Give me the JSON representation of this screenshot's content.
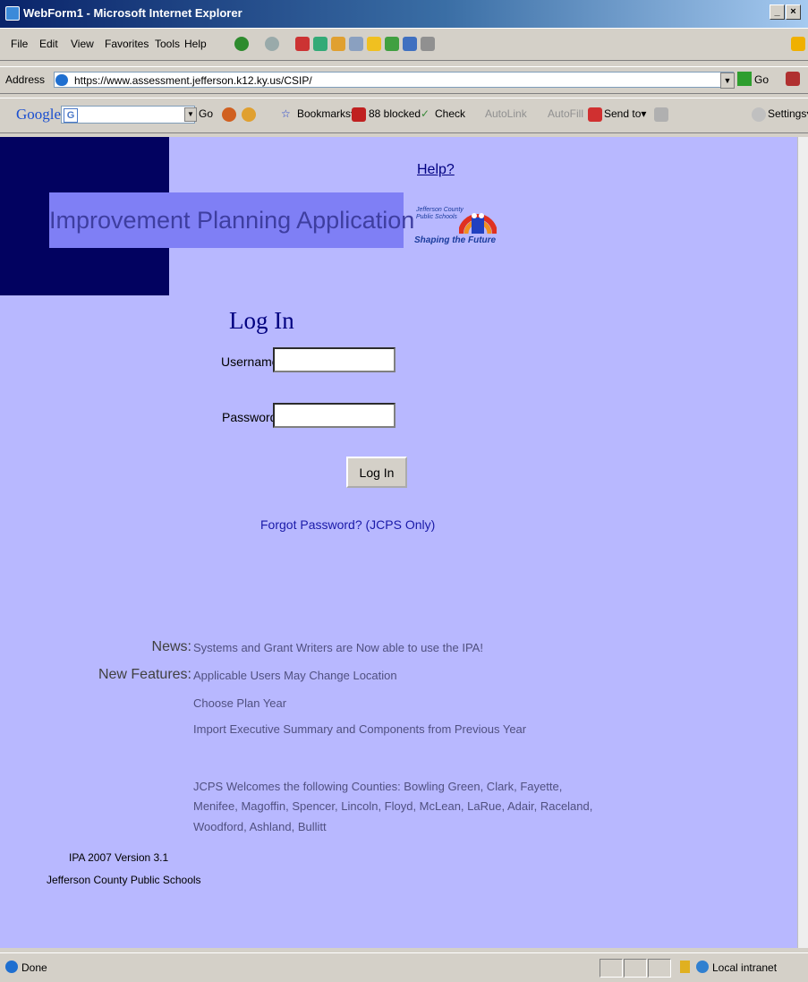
{
  "window": {
    "title": "WebForm1 - Microsoft Internet Explorer",
    "buttons": [
      "_",
      "×"
    ]
  },
  "menu": {
    "items": [
      "File",
      "Edit",
      "View",
      "Favorites",
      "Tools",
      "Help"
    ]
  },
  "address": {
    "label": "Address",
    "url": "https://www.assessment.jefferson.k12.ky.us/CSIP/",
    "go_label": "Go"
  },
  "google_toolbar": {
    "logo": "Google",
    "go_label": "Go",
    "bookmarks_label": "Bookmarks▾",
    "blocked_label": "88 blocked",
    "check_label": "Check",
    "autolink_label": "AutoLink",
    "autofill_label": "AutoFill",
    "sendto_label": "Send to▾",
    "settings_label": "Settings▾"
  },
  "page": {
    "help_link": "Help?",
    "banner_title": "Improvement Planning Application",
    "logo_text": "Jefferson County Public Schools",
    "logo_tagline": "Shaping the Future",
    "login": {
      "title": "Log In",
      "username_label": "Username:",
      "username_value": "",
      "password_label": "Password:",
      "password_value": "",
      "button_label": "Log In",
      "forgot_link": "Forgot Password? (JCPS Only)"
    },
    "news_label": "News:",
    "news_text": "Systems and Grant Writers are Now able to use the IPA!",
    "features_label": "New Features:",
    "features": [
      "Applicable Users May Change Location",
      "Choose Plan Year",
      "Import Executive Summary and Components from Previous Year"
    ],
    "welcome_lines": [
      "JCPS Welcomes the following Counties: Bowling Green, Clark, Fayette,",
      "Menifee, Magoffin, Spencer, Lincoln, Floyd, McLean, LaRue, Adair, Raceland,",
      "Woodford, Ashland, Bullitt"
    ],
    "version": "IPA 2007 Version 3.1",
    "organization": "Jefferson County Public Schools"
  },
  "status": {
    "text": "Done",
    "zone": "Local intranet"
  },
  "colors": {
    "page_bg": "#b8b8ff",
    "navy_block": "#020260",
    "banner_bg": "#7f7ff5",
    "banner_text": "#3e3ea0"
  }
}
